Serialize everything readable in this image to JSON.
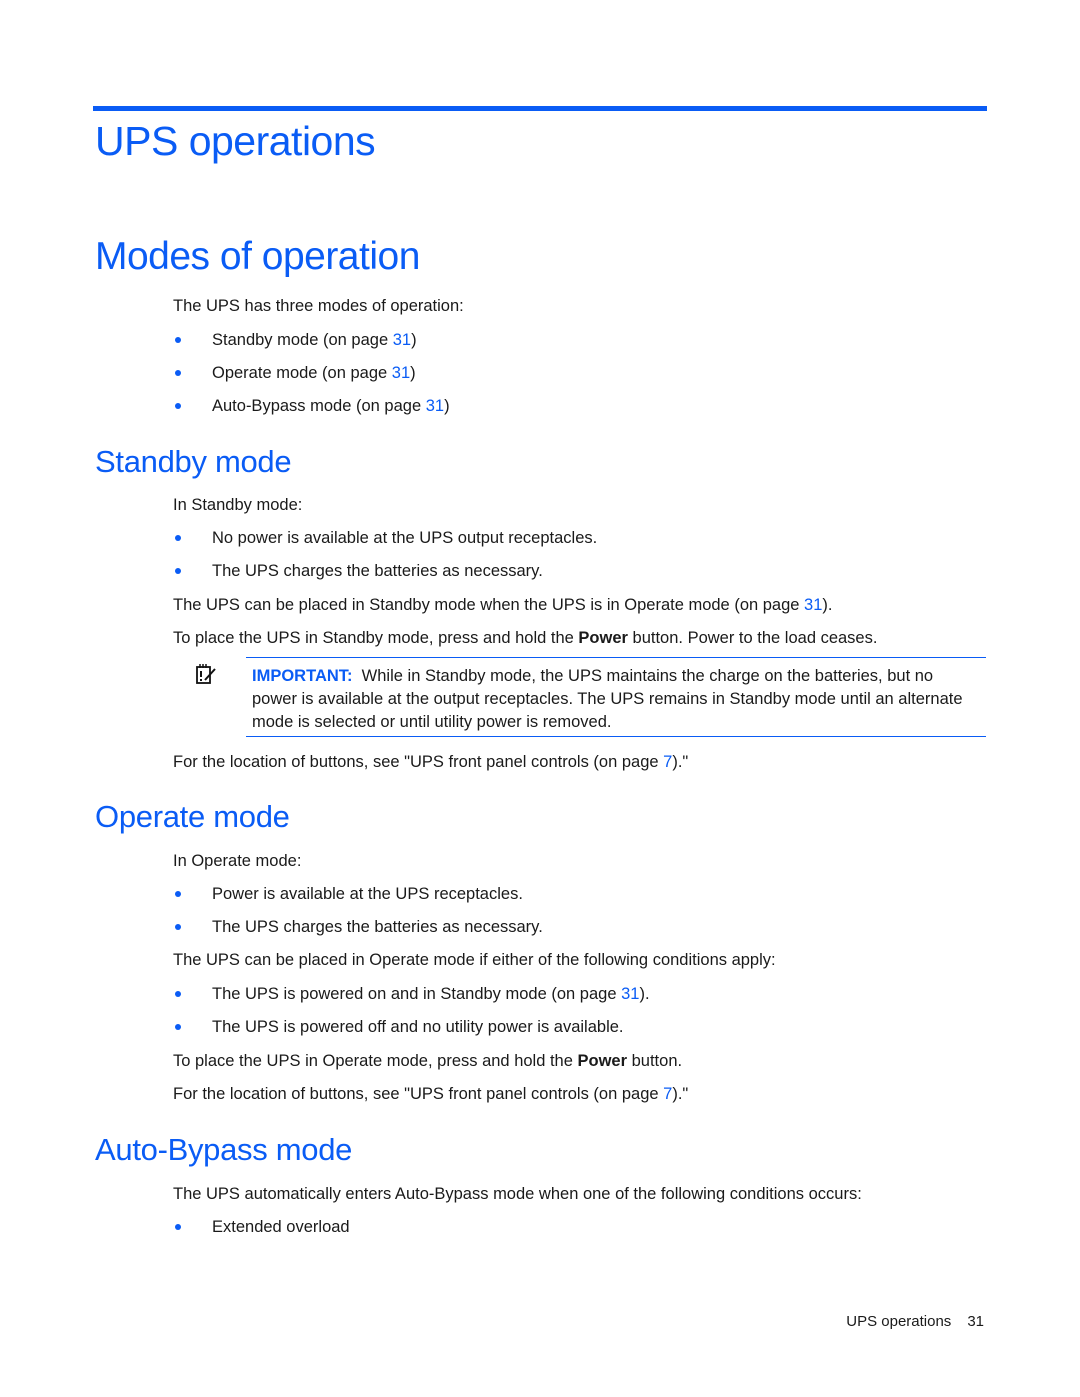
{
  "chapter": {
    "title": "UPS operations"
  },
  "modes_section": {
    "title": "Modes of operation",
    "intro": "The UPS has three modes of operation:",
    "items": [
      {
        "text": "Standby mode (on page ",
        "page": "31",
        "suffix": ")"
      },
      {
        "text": "Operate mode (on page ",
        "page": "31",
        "suffix": ")"
      },
      {
        "text": "Auto-Bypass mode (on page ",
        "page": "31",
        "suffix": ")"
      }
    ]
  },
  "standby": {
    "title": "Standby mode",
    "intro": "In Standby mode:",
    "bullets": [
      "No power is available at the UPS output receptacles.",
      "The UPS charges the batteries as necessary."
    ],
    "para1_text": "The UPS can be placed in Standby mode when the UPS is in Operate mode (on page ",
    "para1_page": "31",
    "para1_suffix": ").",
    "para2_pre": "To place the UPS in Standby mode, press and hold the ",
    "para2_bold": "Power",
    "para2_post": " button. Power to the load ceases.",
    "note": {
      "icon": "important-notepad-icon",
      "label": "IMPORTANT:",
      "text": "  While in Standby mode, the UPS maintains the charge on the batteries, but no power is available at the output receptacles. The UPS remains in Standby mode until an alternate mode is selected or until utility power is removed."
    },
    "location_pre": "For the location of buttons, see \"UPS front panel controls (on page ",
    "location_page": "7",
    "location_post": ").\""
  },
  "operate": {
    "title": "Operate mode",
    "intro": "In Operate mode:",
    "bullets": [
      "Power is available at the UPS receptacles.",
      "The UPS charges the batteries as necessary."
    ],
    "conditions_intro": "The UPS can be placed in Operate mode if either of the following conditions apply:",
    "condition1_text": "The UPS is powered on and in Standby mode (on page ",
    "condition1_page": "31",
    "condition1_suffix": ").",
    "condition2_text": "The UPS is powered off and no utility power is available.",
    "place_pre": "To place the UPS in Operate mode, press and hold the ",
    "place_bold": "Power",
    "place_post": " button.",
    "location_pre": "For the location of buttons, see \"UPS front panel controls (on page ",
    "location_page": "7",
    "location_post": ").\""
  },
  "autobypass": {
    "title": "Auto-Bypass mode",
    "intro": "The UPS automatically enters Auto-Bypass mode when one of the following conditions occurs:",
    "bullets": [
      "Extended overload"
    ]
  },
  "footer": {
    "section": "UPS operations",
    "page_number": "31"
  },
  "colors": {
    "accent": "#0a5cf5",
    "text": "#1a1a1a"
  }
}
